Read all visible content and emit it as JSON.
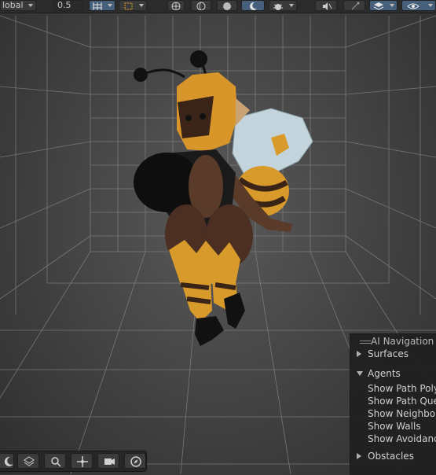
{
  "toolbar": {
    "pivot_rotation": "lobal",
    "snap_increment": "0.5"
  },
  "ai_navigation": {
    "title": "AI Navigation",
    "surfaces": "Surfaces",
    "agents": "Agents",
    "agent_options": [
      "Show Path Polygons",
      "Show Path Query Nodes",
      "Show Neighbours",
      "Show Walls",
      "Show Avoidance"
    ],
    "obstacles": "Obstacles"
  },
  "colors": {
    "viewport_bg": "#4a4a4a",
    "grid_line": "#8c8c8c",
    "active_button": "#46607c",
    "character_yellow": "#d89a2a",
    "character_brown": "#4a2f22"
  },
  "icons": {
    "bottom_toolbar": [
      "orbit-icon",
      "layers-icon",
      "search-icon",
      "move-icon",
      "camera-icon",
      "compass-icon"
    ]
  }
}
